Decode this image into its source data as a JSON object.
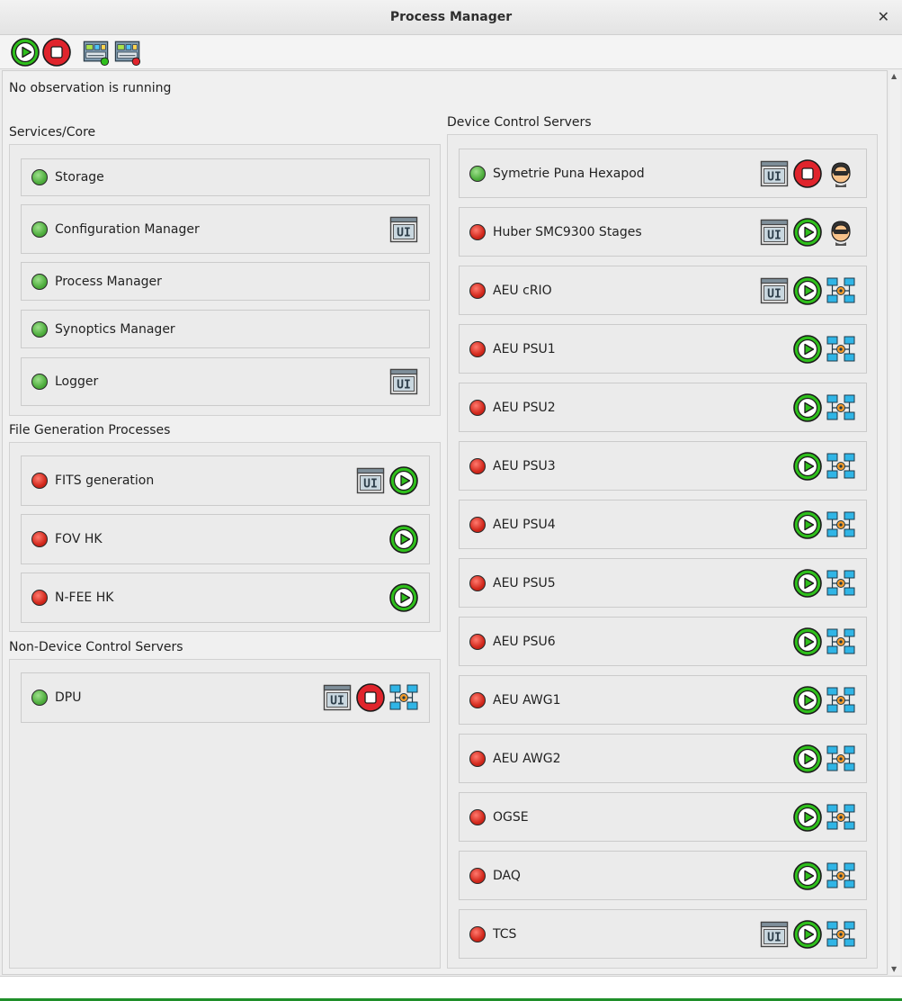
{
  "window": {
    "title": "Process Manager"
  },
  "toolbar": {
    "buttons": [
      "start-all",
      "stop-all",
      "control-panel-start",
      "control-panel-stop"
    ]
  },
  "status": "No observation is running",
  "colors": {
    "running": "#4fae3e",
    "stopped": "#d2281c",
    "start": "#2fbf1c",
    "stop": "#e0242c"
  },
  "sections": {
    "core": {
      "label": "Services/Core",
      "items": [
        {
          "label": "Storage",
          "state": "running"
        },
        {
          "label": "Configuration Manager",
          "state": "running"
        },
        {
          "label": "Process Manager",
          "state": "running"
        },
        {
          "label": "Synoptics Manager",
          "state": "running"
        },
        {
          "label": "Logger",
          "state": "running"
        }
      ]
    },
    "filegen": {
      "label": "File Generation Processes",
      "items": [
        {
          "label": "FITS generation",
          "state": "stopped"
        },
        {
          "label": "FOV HK",
          "state": "stopped"
        },
        {
          "label": "N-FEE HK",
          "state": "stopped"
        }
      ]
    },
    "nondevice": {
      "label": "Non-Device Control Servers",
      "items": [
        {
          "label": "DPU",
          "state": "running"
        }
      ]
    },
    "device": {
      "label": "Device Control Servers",
      "items": [
        {
          "label": "Symetrie Puna Hexapod",
          "state": "running"
        },
        {
          "label": "Huber SMC9300 Stages",
          "state": "stopped"
        },
        {
          "label": "AEU cRIO",
          "state": "stopped"
        },
        {
          "label": "AEU PSU1",
          "state": "stopped"
        },
        {
          "label": "AEU PSU2",
          "state": "stopped"
        },
        {
          "label": "AEU PSU3",
          "state": "stopped"
        },
        {
          "label": "AEU PSU4",
          "state": "stopped"
        },
        {
          "label": "AEU PSU5",
          "state": "stopped"
        },
        {
          "label": "AEU PSU6",
          "state": "stopped"
        },
        {
          "label": "AEU AWG1",
          "state": "stopped"
        },
        {
          "label": "AEU AWG2",
          "state": "stopped"
        },
        {
          "label": "OGSE",
          "state": "stopped"
        },
        {
          "label": "DAQ",
          "state": "stopped"
        },
        {
          "label": "TCS",
          "state": "stopped"
        }
      ]
    }
  }
}
